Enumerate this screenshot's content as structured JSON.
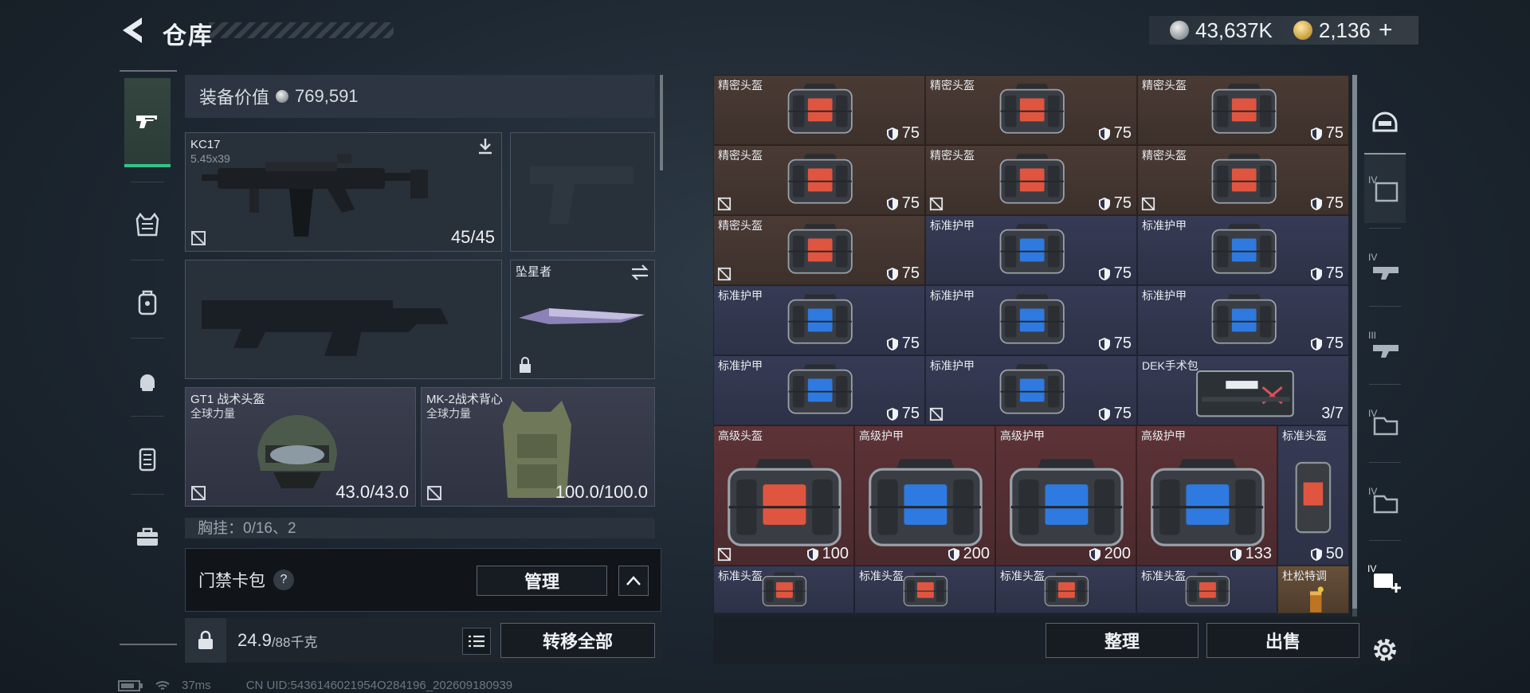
{
  "header": {
    "title": "仓库",
    "currency_silver": "43,637K",
    "currency_gold": "2,136"
  },
  "nav": [
    "pistol-icon",
    "armor-vest-icon",
    "backpack-icon",
    "helmet-bag-icon",
    "locker-icon",
    "toolbox-icon"
  ],
  "equipment": {
    "value_label": "装备价值",
    "value": "769,591",
    "primary": {
      "name": "KC17",
      "caliber": "5.45x39",
      "ammo": "45/45"
    },
    "melee": {
      "name": "坠星者"
    },
    "helmet": {
      "name": "GT1 战术头盔",
      "tag": "全球力量",
      "durability": "43.0/43.0"
    },
    "vest": {
      "name": "MK-2战术背心",
      "tag": "全球力量",
      "durability": "100.0/100.0"
    },
    "chest_rig": "胸挂：0/16、2"
  },
  "card_pack": {
    "label": "门禁卡包",
    "help": "?",
    "manage": "管理"
  },
  "weight": {
    "current": "24.9",
    "max": "/88千克"
  },
  "transfer_all": "转移全部",
  "inventory": {
    "items": [
      {
        "name": "精密头盔",
        "value": "75",
        "color": "brown",
        "bag": "bag-1",
        "type": "helmet"
      },
      {
        "name": "精密头盔",
        "value": "75",
        "color": "brown",
        "bag": "bag-1",
        "type": "helmet"
      },
      {
        "name": "精密头盔",
        "value": "75",
        "color": "brown",
        "bag": "bag-1",
        "type": "helmet"
      },
      {
        "name": "精密头盔",
        "value": "75",
        "color": "brown",
        "bag": "bag-1",
        "type": "helmet",
        "noicon": true
      },
      {
        "name": "精密头盔",
        "value": "75",
        "color": "brown",
        "bag": "bag-1",
        "type": "helmet",
        "noicon": true
      },
      {
        "name": "精密头盔",
        "value": "75",
        "color": "brown",
        "bag": "bag-1",
        "type": "helmet",
        "noicon": true
      },
      {
        "name": "精密头盔",
        "value": "75",
        "color": "brown",
        "bag": "bag-1",
        "type": "helmet",
        "noicon": true
      },
      {
        "name": "标准护甲",
        "value": "75",
        "color": "purple",
        "bag": "bag-1",
        "type": "armor"
      },
      {
        "name": "标准护甲",
        "value": "75",
        "color": "purple",
        "bag": "bag-1",
        "type": "armor"
      },
      {
        "name": "标准护甲",
        "value": "75",
        "color": "purple",
        "bag": "bag-1",
        "type": "armor"
      },
      {
        "name": "标准护甲",
        "value": "75",
        "color": "purple",
        "bag": "bag-1",
        "type": "armor"
      },
      {
        "name": "标准护甲",
        "value": "75",
        "color": "purple",
        "bag": "bag-1",
        "type": "armor"
      },
      {
        "name": "标准护甲",
        "value": "75",
        "color": "purple",
        "bag": "bag-1",
        "type": "armor"
      },
      {
        "name": "标准护甲",
        "value": "75",
        "color": "purple",
        "bag": "bag-1",
        "type": "armor",
        "noicon": true
      },
      {
        "name": "DEK手术包",
        "value": "3/7",
        "color": "purple",
        "bag": "medkit",
        "type": "medkit"
      },
      {
        "name": "高级头盔",
        "value": "100",
        "color": "red",
        "bag": "bag-2",
        "type": "helmet",
        "noicon": true
      },
      {
        "name": "高级护甲",
        "value": "200",
        "color": "red",
        "bag": "bag-2",
        "type": "armor"
      },
      {
        "name": "高级护甲",
        "value": "200",
        "color": "red",
        "bag": "bag-2",
        "type": "armor"
      },
      {
        "name": "高级护甲",
        "value": "133",
        "color": "red",
        "bag": "bag-2",
        "type": "armor"
      },
      {
        "name": "标准头盔",
        "value": "50",
        "color": "purple",
        "bag": "mini",
        "type": "helmet"
      },
      {
        "name": "标准头盔",
        "value": "",
        "color": "purple",
        "bag": "bag-1",
        "type": "helmet"
      },
      {
        "name": "标准头盔",
        "value": "",
        "color": "purple",
        "bag": "bag-1",
        "type": "helmet"
      },
      {
        "name": "标准头盔",
        "value": "",
        "color": "purple",
        "bag": "bag-1",
        "type": "helmet"
      },
      {
        "name": "标准头盔",
        "value": "",
        "color": "purple",
        "bag": "bag-1",
        "type": "helmet"
      },
      {
        "name": "杜松特调",
        "value": "",
        "color": "gold",
        "bag": "drink",
        "type": "drink"
      }
    ]
  },
  "buttons": {
    "sort": "整理",
    "sell": "出售"
  },
  "right_tabs": [
    "helmet-tab-icon",
    "storage-iv-icon",
    "storage-iv-2-icon",
    "storage-iii-icon",
    "storage-iv-3-icon",
    "storage-iv-4-icon",
    "add-storage-icon",
    "settings-icon"
  ],
  "footer": {
    "ping": "37ms",
    "uid": "CN UID:5436146021954O284196_202609180939"
  }
}
